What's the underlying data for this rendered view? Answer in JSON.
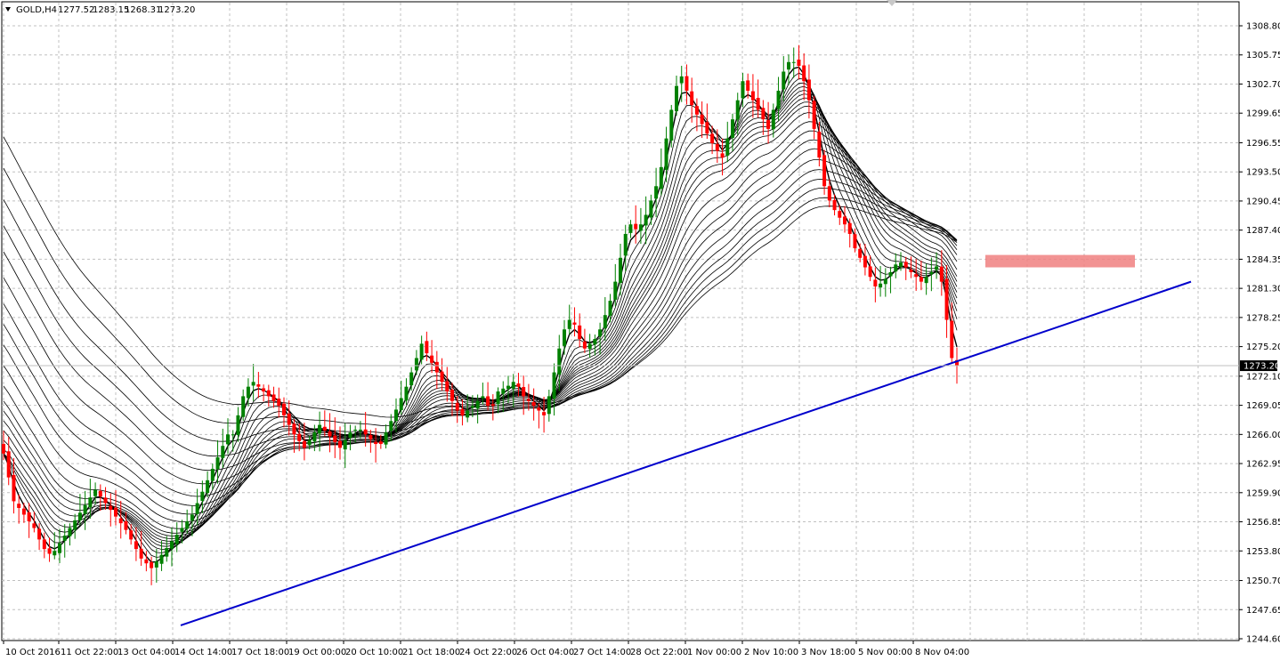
{
  "header": {
    "symbol": "GOLD,H4",
    "open": "1277.52",
    "high": "1283.15",
    "low": "1268.31",
    "close": "1273.20"
  },
  "chart_data": {
    "type": "candlestick",
    "symbol": "GOLD",
    "timeframe": "H4",
    "current_price": 1273.2,
    "ylim": [
      1244.6,
      1308.8
    ],
    "y_ticks": [
      "1308.80",
      "1305.75",
      "1302.70",
      "1299.65",
      "1296.55",
      "1293.50",
      "1290.45",
      "1287.40",
      "1284.35",
      "1281.30",
      "1278.25",
      "1275.20",
      "1272.10",
      "1269.05",
      "1266.00",
      "1262.95",
      "1259.90",
      "1256.85",
      "1253.80",
      "1250.70",
      "1247.65",
      "1244.60"
    ],
    "x_labels": [
      "10 Oct 2016",
      "11 Oct 22:00",
      "13 Oct 04:00",
      "14 Oct 14:00",
      "17 Oct 18:00",
      "19 Oct 00:00",
      "20 Oct 10:00",
      "21 Oct 18:00",
      "24 Oct 22:00",
      "26 Oct 04:00",
      "27 Oct 14:00",
      "28 Oct 22:00",
      "1 Nov 00:00",
      "2 Nov 10:00",
      "3 Nov 18:00",
      "5 Nov 00:00",
      "8 Nov 04:00"
    ],
    "close_path": [
      1264.0,
      1261.5,
      1259.0,
      1258.3,
      1257.6,
      1256.9,
      1256.2,
      1255.0,
      1254.0,
      1253.5,
      1253.8,
      1254.6,
      1255.4,
      1256.2,
      1257.0,
      1257.8,
      1258.6,
      1259.4,
      1260.2,
      1259.5,
      1258.8,
      1258.1,
      1257.4,
      1256.7,
      1256.0,
      1255.0,
      1254.0,
      1253.0,
      1252.5,
      1252.0,
      1252.7,
      1253.4,
      1254.1,
      1254.8,
      1255.5,
      1256.2,
      1256.9,
      1257.6,
      1258.8,
      1260.0,
      1261.2,
      1262.4,
      1263.6,
      1264.8,
      1266.0,
      1266.0,
      1268.0,
      1270.0,
      1271.0,
      1271.5,
      1271.0,
      1270.5,
      1270.0,
      1269.5,
      1269.0,
      1268.0,
      1267.0,
      1266.0,
      1265.3,
      1264.6,
      1265.4,
      1266.2,
      1267.0,
      1266.4,
      1265.8,
      1265.2,
      1264.6,
      1265.4,
      1266.2,
      1266.5,
      1266.5,
      1266.0,
      1265.5,
      1265.0,
      1265.0,
      1266.2,
      1267.4,
      1268.6,
      1269.8,
      1271.0,
      1272.5,
      1274.0,
      1275.5,
      1274.5,
      1273.5,
      1272.5,
      1271.5,
      1270.5,
      1269.5,
      1268.5,
      1268.0,
      1268.5,
      1269.0,
      1269.5,
      1270.0,
      1269.0,
      1269.0,
      1270.5,
      1270.8,
      1271.1,
      1271.5,
      1271.0,
      1270.0,
      1269.5,
      1269.0,
      1268.5,
      1268.0,
      1270.0,
      1272.5,
      1275.0,
      1277.0,
      1278.0,
      1277.5,
      1276.0,
      1275.0,
      1275.5,
      1276.0,
      1277.0,
      1278.5,
      1280.0,
      1282.0,
      1284.5,
      1287.0,
      1288.0,
      1287.5,
      1288.0,
      1289.0,
      1290.5,
      1292.0,
      1294.0,
      1297.0,
      1300.0,
      1302.5,
      1303.5,
      1302.0,
      1300.5,
      1299.5,
      1298.5,
      1297.5,
      1296.5,
      1295.7,
      1295.0,
      1297.0,
      1299.0,
      1301.0,
      1303.0,
      1302.0,
      1301.0,
      1300.0,
      1299.0,
      1298.0,
      1300.0,
      1302.0,
      1304.0,
      1305.0,
      1305.0,
      1304.6,
      1303.0,
      1301.0,
      1298.0,
      1295.0,
      1292.0,
      1290.5,
      1289.5,
      1288.7,
      1288.0,
      1287.0,
      1285.5,
      1284.5,
      1283.5,
      1282.5,
      1281.5,
      1281.8,
      1282.3,
      1283.0,
      1283.8,
      1284.0,
      1283.5,
      1283.0,
      1282.5,
      1282.0,
      1282.5,
      1283.0,
      1283.6,
      1282.0,
      1278.0,
      1274.0,
      1273.2
    ],
    "ema_periods": [
      3,
      5,
      7,
      9,
      11,
      13,
      15,
      17,
      19,
      21,
      24,
      28,
      32,
      36,
      40,
      45,
      50,
      55,
      60,
      66,
      72
    ],
    "trendline": {
      "from": {
        "x": "14 Oct 14:00",
        "y": 1246.0
      },
      "to": {
        "x": "9 Nov",
        "y": 1282.0
      },
      "color": "#0000cc"
    },
    "zone": {
      "price_range": [
        1283.5,
        1284.8
      ],
      "x_range": [
        "8 Nov",
        "9 Nov"
      ],
      "color": "#f08080"
    },
    "colors": {
      "bull_candle": "#008000",
      "bear_candle": "#ff0000",
      "ma_lines": "#000000",
      "price_tag_bg": "#000000",
      "price_tag_text": "#ffffff"
    }
  }
}
